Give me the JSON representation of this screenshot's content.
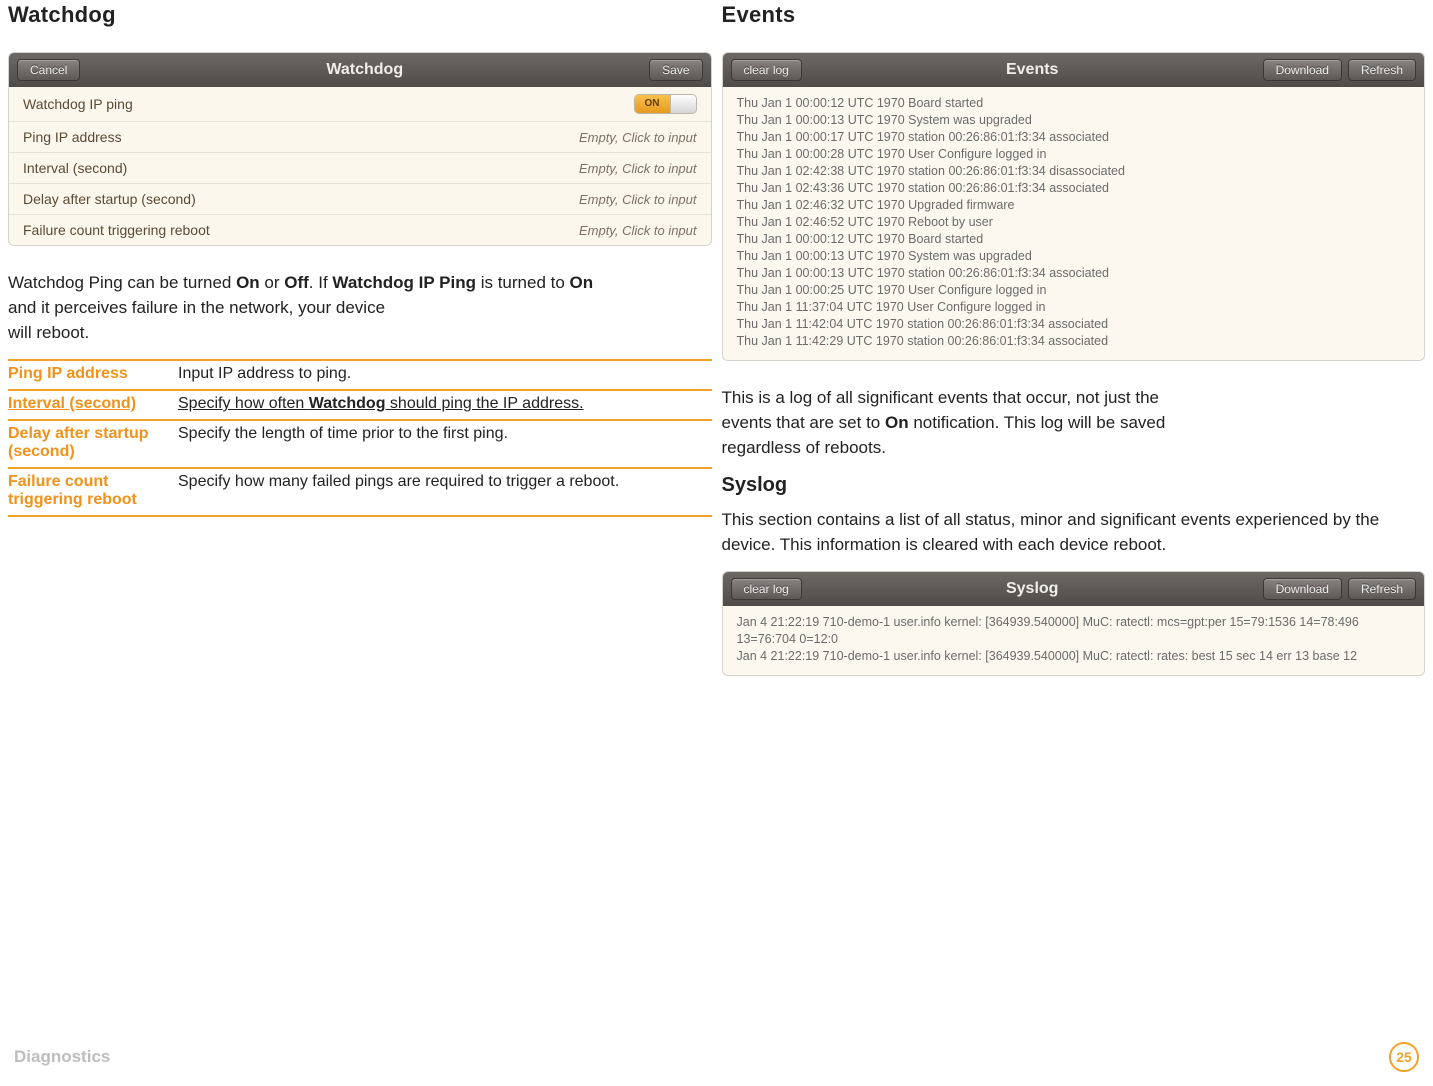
{
  "left": {
    "heading": "Watchdog",
    "panel": {
      "title": "Watchdog",
      "btn_cancel": "Cancel",
      "btn_save": "Save",
      "rows": [
        {
          "label": "Watchdog IP ping",
          "value": "ON",
          "type": "toggle"
        },
        {
          "label": "Ping IP address",
          "value": "Empty, Click to input",
          "type": "text"
        },
        {
          "label": "Interval (second)",
          "value": "Empty, Click to input",
          "type": "text"
        },
        {
          "label": "Delay after startup (second)",
          "value": "Empty, Click to input",
          "type": "text"
        },
        {
          "label": "Failure count triggering reboot",
          "value": "Empty, Click to input",
          "type": "text"
        }
      ]
    },
    "para": {
      "t1a": "Watchdog Ping can be turned ",
      "on": "On",
      "t1b": " or ",
      "off": "Off",
      "t1c": ". If ",
      "wipp": "Watchdog IP Ping",
      "t1d": " is turned to ",
      "on2": "On",
      "t2": "and it perceives failure in the network, your device",
      "t3": "will reboot."
    },
    "desc": [
      {
        "k": "Ping IP address",
        "v": "Input IP address to ping."
      },
      {
        "k": "Interval (second)",
        "v_pre": "Specify how often ",
        "v_bold": "Watchdog",
        "v_post": " should ping the IP address."
      },
      {
        "k": "Delay after startup (second)",
        "v": "Specify the length of time prior to the first ping."
      },
      {
        "k": "Failure count triggering reboot",
        "v": "Specify how many failed pings are required to trigger a reboot."
      }
    ]
  },
  "right": {
    "events_heading": "Events",
    "events_panel": {
      "title": "Events",
      "btn_clear": "clear log",
      "btn_download": "Download",
      "btn_refresh": "Refresh",
      "lines": [
        "Thu Jan 1 00:00:12 UTC 1970 Board started",
        "Thu Jan 1 00:00:13 UTC 1970 System was upgraded",
        "Thu Jan 1 00:00:17 UTC 1970 station 00:26:86:01:f3:34 associated",
        "Thu Jan 1 00:00:28 UTC 1970 User Configure logged in",
        "Thu Jan 1 02:42:38 UTC 1970 station 00:26:86:01:f3:34 disassociated",
        "Thu Jan 1 02:43:36 UTC 1970 station 00:26:86:01:f3:34 associated",
        "Thu Jan 1 02:46:32 UTC 1970 Upgraded firmware",
        "Thu Jan 1 02:46:52 UTC 1970 Reboot by user",
        "Thu Jan 1 00:00:12 UTC 1970 Board started",
        "Thu Jan 1 00:00:13 UTC 1970 System was upgraded",
        "Thu Jan 1 00:00:13 UTC 1970 station 00:26:86:01:f3:34 associated",
        "Thu Jan 1 00:00:25 UTC 1970 User Configure logged in",
        "Thu Jan 1 11:37:04 UTC 1970 User Configure logged in",
        "Thu Jan 1 11:42:04 UTC 1970 station 00:26:86:01:f3:34 associated",
        "Thu Jan 1 11:42:29 UTC 1970 station 00:26:86:01:f3:34 associated"
      ]
    },
    "events_para": {
      "t1": "This is a log of all significant events that occur, not just the",
      "t2a": "events that are set to ",
      "on": "On",
      "t2b": " notification. This log will be saved",
      "t3": "regardless of reboots."
    },
    "syslog_heading": "Syslog",
    "syslog_para": "This section contains a list of all status, minor and significant events experienced by the device. This information is cleared with each device reboot.",
    "syslog_panel": {
      "title": "Syslog",
      "btn_clear": "clear log",
      "btn_download": "Download",
      "btn_refresh": "Refresh",
      "lines": [
        "Jan 4 21:22:19 710-demo-1 user.info kernel: [364939.540000] MuC: ratectl: mcs=gpt:per 15=79:1536 14=78:496 13=76:704 0=12:0",
        "Jan 4 21:22:19 710-demo-1 user.info kernel: [364939.540000] MuC: ratectl: rates: best 15 sec 14 err 13 base 12"
      ]
    }
  },
  "footer": {
    "section": "Diagnostics",
    "page": "25"
  }
}
